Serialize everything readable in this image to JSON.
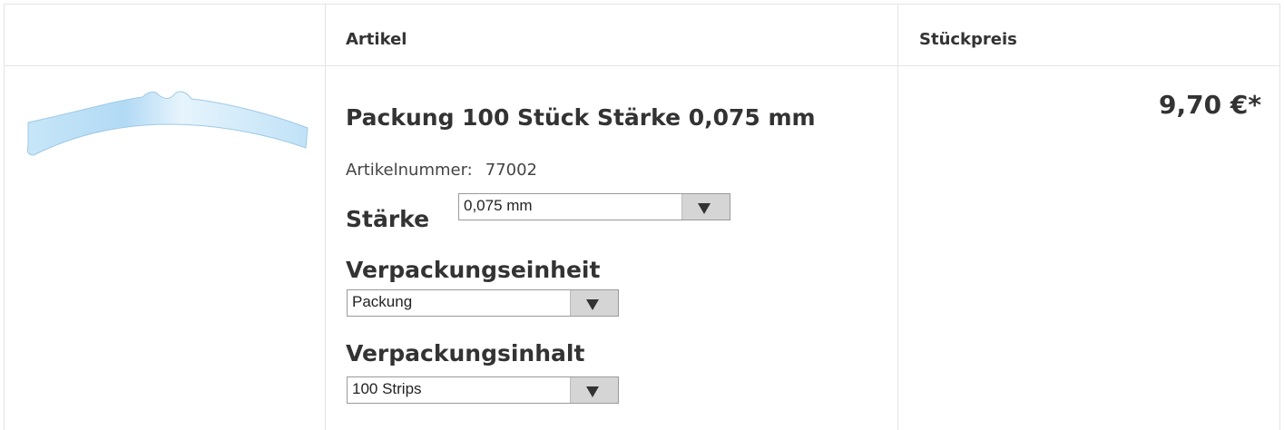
{
  "table": {
    "headers": {
      "image": "",
      "article": "Artikel",
      "unit_price": "Stückpreis"
    }
  },
  "product": {
    "image_alt": "transparent strip",
    "title": "Packung 100 Stück Stärke 0,075 mm",
    "article_number_label": "Artikelnummer:",
    "article_number": "77002",
    "options": {
      "staerke": {
        "label": "Stärke",
        "selected": "0,075 mm"
      },
      "verpackungseinheit": {
        "label": "Verpackungseinheit",
        "selected": "Packung"
      },
      "verpackungsinhalt": {
        "label": "Verpackungsinhalt",
        "selected": "100 Strips"
      }
    },
    "price": "9,70 €*"
  },
  "colors": {
    "border": "#e4e4e4",
    "strip": "#bfe0f7",
    "select_arrow_bg": "#d5d5d5"
  },
  "icons": {
    "dropdown": "triangle-down-icon"
  }
}
